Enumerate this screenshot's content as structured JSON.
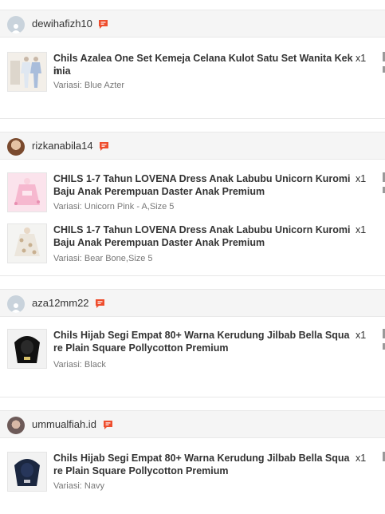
{
  "orders": [
    {
      "username": "dewihafizh10",
      "avatar": "default-user-icon",
      "items": [
        {
          "name": "Chils Azalea One Set Kemeja Celana Kulot Satu Set Wanita Kekinia",
          "qty": "x1",
          "name_tail": "n",
          "variant": "Variasi: Blue Azter"
        }
      ]
    },
    {
      "username": "rizkanabila14",
      "avatar": "user-photo",
      "items": [
        {
          "name": "CHILS 1-7 Tahun LOVENA Dress Anak Labubu Unicorn Kuromi Baju Anak Perempuan Daster Anak Premium",
          "qty": "x1",
          "variant": "Variasi: Unicorn Pink - A,Size 5"
        },
        {
          "name": "CHILS 1-7 Tahun LOVENA Dress Anak Labubu Unicorn Kuromi Baju Anak Perempuan Daster Anak Premium",
          "qty": "x1",
          "variant": "Variasi: Bear Bone,Size 5"
        }
      ]
    },
    {
      "username": "aza12mm22",
      "avatar": "default-user-icon",
      "items": [
        {
          "name": "Chils Hijab Segi Empat 80+ Warna Kerudung Jilbab Bella Square Plain Square Pollycotton Premium",
          "qty": "x1",
          "variant": "Variasi: Black"
        }
      ]
    },
    {
      "username": "ummualfiah.id",
      "avatar": "user-photo",
      "items": [
        {
          "name": "Chils Hijab Segi Empat 80+ Warna Kerudung Jilbab Bella Square Plain Square Pollycotton Premium",
          "qty": "x1",
          "variant": "Variasi: Navy"
        }
      ]
    }
  ],
  "colors": {
    "chat_accent": "#ee4d2d",
    "header_bg": "#f5f5f5",
    "variant_text": "#777777"
  }
}
